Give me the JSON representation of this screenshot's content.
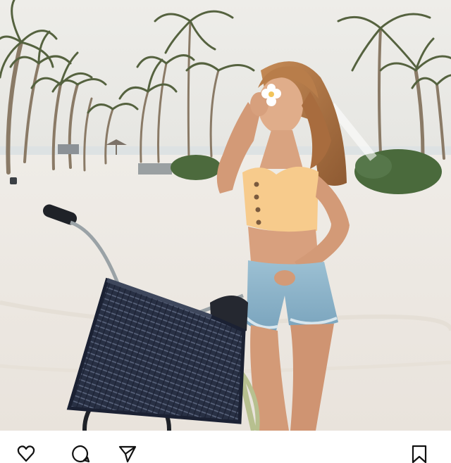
{
  "post": {
    "photo": {
      "icon": "beach-bicycle-photo",
      "colors": {
        "sky": "#ecebe6",
        "sand": "#efebe6",
        "sea": "#dfe3e4",
        "palm": "#5f6b4a",
        "trunk": "#8a7a66",
        "shrub": "#4c6a3d",
        "skin": "#d8a07e",
        "hair": "#b07444",
        "top": "#f7cb8c",
        "shorts": "#8fb6cc",
        "basket": "#2a3040",
        "bike_frame": "#b7c08f",
        "chrome": "#9aa2a6"
      }
    },
    "actions": {
      "like_icon": "heart-icon",
      "comment_icon": "comment-icon",
      "share_icon": "share-icon",
      "save_icon": "bookmark-icon"
    }
  }
}
